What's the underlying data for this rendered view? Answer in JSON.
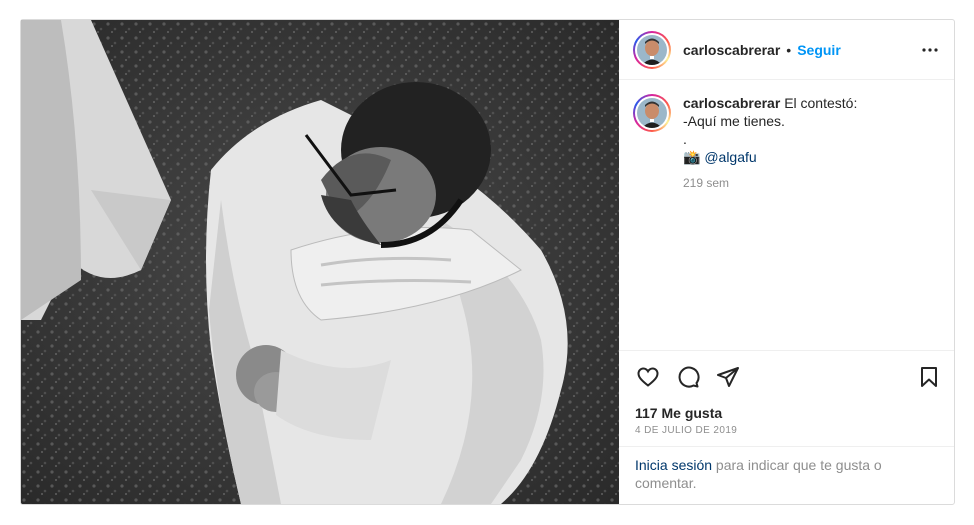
{
  "post": {
    "username": "carloscabrerar",
    "separator": "•",
    "follow_label": "Seguir",
    "caption": {
      "username": "carloscabrerar",
      "line1": "El contestó:",
      "line2": "-Aquí me tienes.",
      "line3": ".",
      "camera_emoji": "📸",
      "mention": "@algafu",
      "time_ago": "219 sem"
    },
    "likes": "117 Me gusta",
    "date": "4 DE JULIO DE 2019",
    "login_link": "Inicia sesión",
    "login_text": " para indicar que te gusta o comentar."
  },
  "icons": {
    "more": "more-horizontal-icon",
    "like": "heart-icon",
    "comment": "comment-icon",
    "share": "share-icon",
    "save": "bookmark-icon"
  }
}
